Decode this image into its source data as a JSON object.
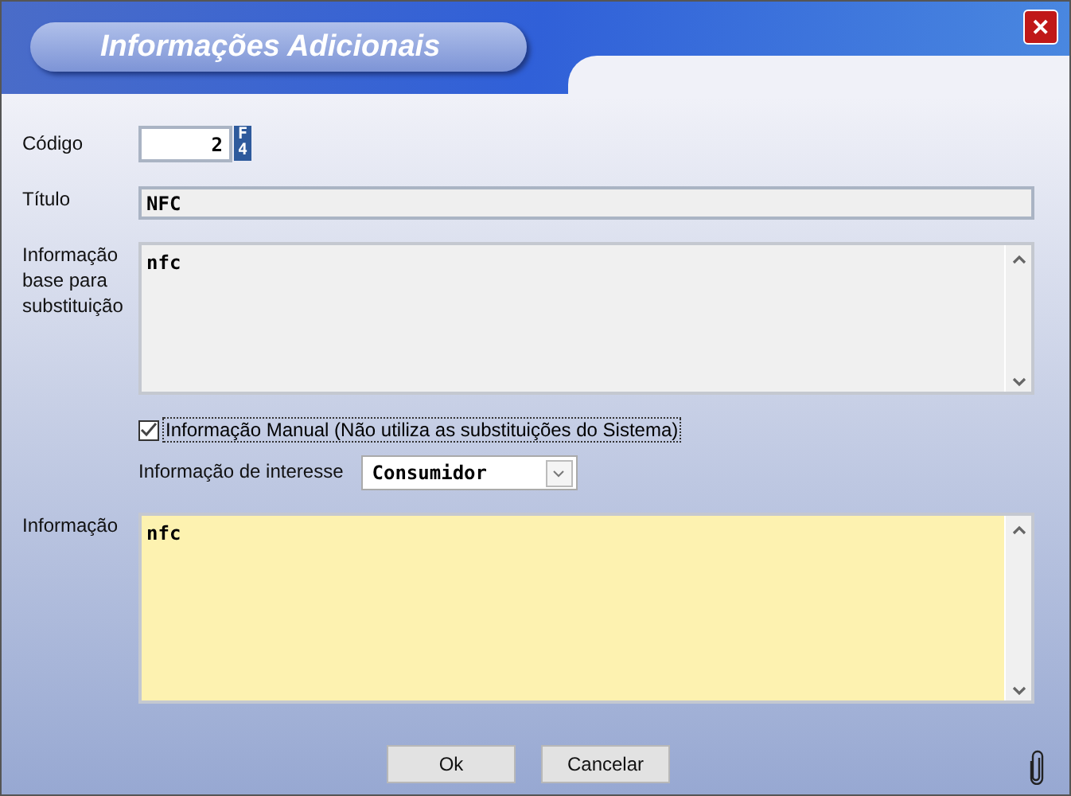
{
  "window": {
    "title": "Informações Adicionais",
    "close": "✕"
  },
  "fields": {
    "codigo": {
      "label": "Código",
      "value": "2",
      "lookup": "F4"
    },
    "titulo": {
      "label": "Título",
      "value": "NFC"
    },
    "base": {
      "label": "Informação base para substituição",
      "value": "nfc"
    },
    "manual": {
      "label": "Informação Manual (Não utiliza as substituições do Sistema)",
      "checked": true
    },
    "interesse": {
      "label": "Informação de interesse",
      "value": "Consumidor"
    },
    "informacao": {
      "label": "Informação",
      "value": "nfc"
    }
  },
  "buttons": [
    {
      "label": "Ok"
    },
    {
      "label": "Cancelar"
    }
  ]
}
